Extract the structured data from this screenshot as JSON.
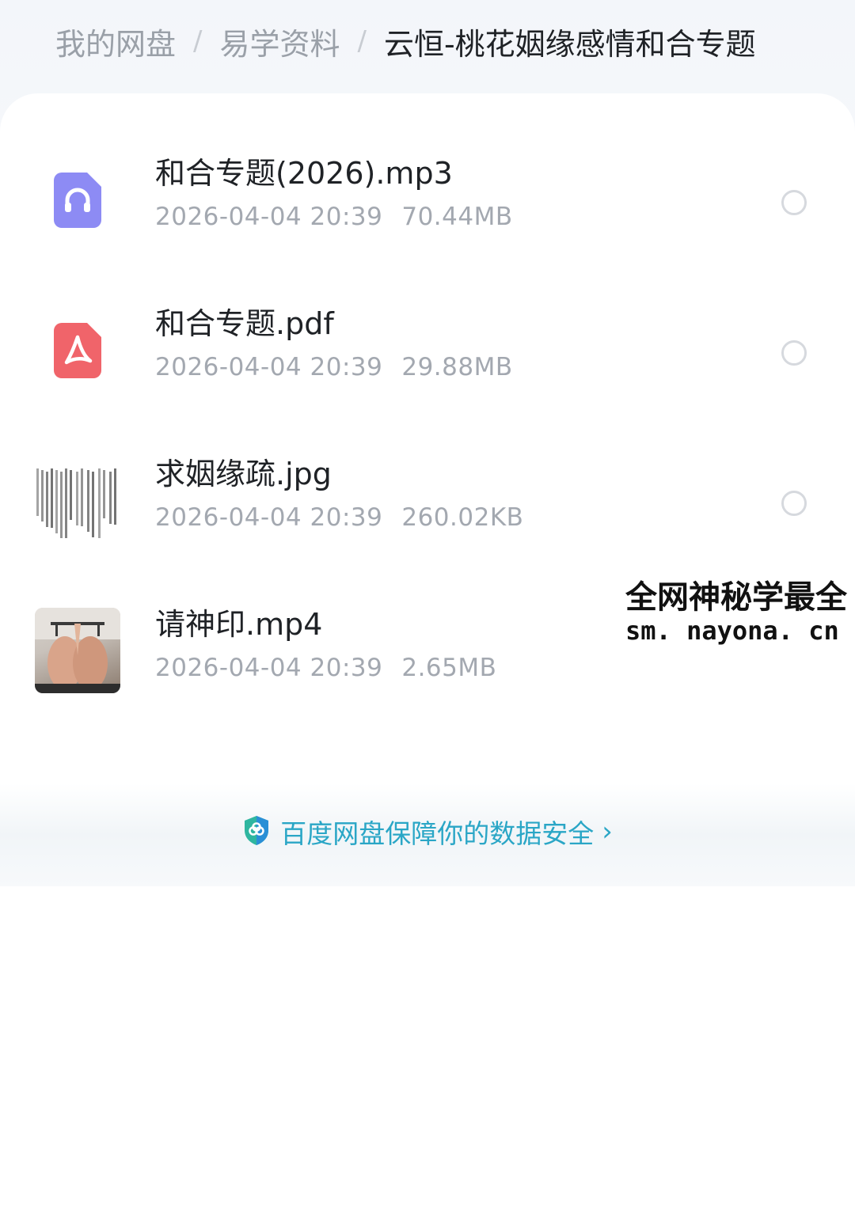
{
  "breadcrumb": [
    {
      "label": "我的网盘"
    },
    {
      "label": "易学资料"
    },
    {
      "label": "云恒-桃花姻缘感情和合专题"
    }
  ],
  "breadcrumb_separator": "/",
  "files": [
    {
      "name": "和合专题(2026).mp3",
      "date": "2026-04-04  20:39",
      "size": "70.44MB",
      "icon": "audio-file-icon",
      "icon_color": "#8d8bf4"
    },
    {
      "name": "和合专题.pdf",
      "date": "2026-04-04  20:39",
      "size": "29.88MB",
      "icon": "pdf-file-icon",
      "icon_color": "#f0646a"
    },
    {
      "name": "求姻缘疏.jpg",
      "date": "2026-04-04  20:39",
      "size": "260.02KB",
      "icon": "image-thumbnail"
    },
    {
      "name": "请神印.mp4",
      "date": "2026-04-04  20:39",
      "size": "2.65MB",
      "icon": "video-thumbnail"
    }
  ],
  "watermark": {
    "line1": "全网神秘学最全",
    "line2": "sm. nayona. cn"
  },
  "security_notice": {
    "text": "百度网盘保障你的数据安全",
    "icon": "shield-icon",
    "accent_color": "#2aa6c6"
  }
}
